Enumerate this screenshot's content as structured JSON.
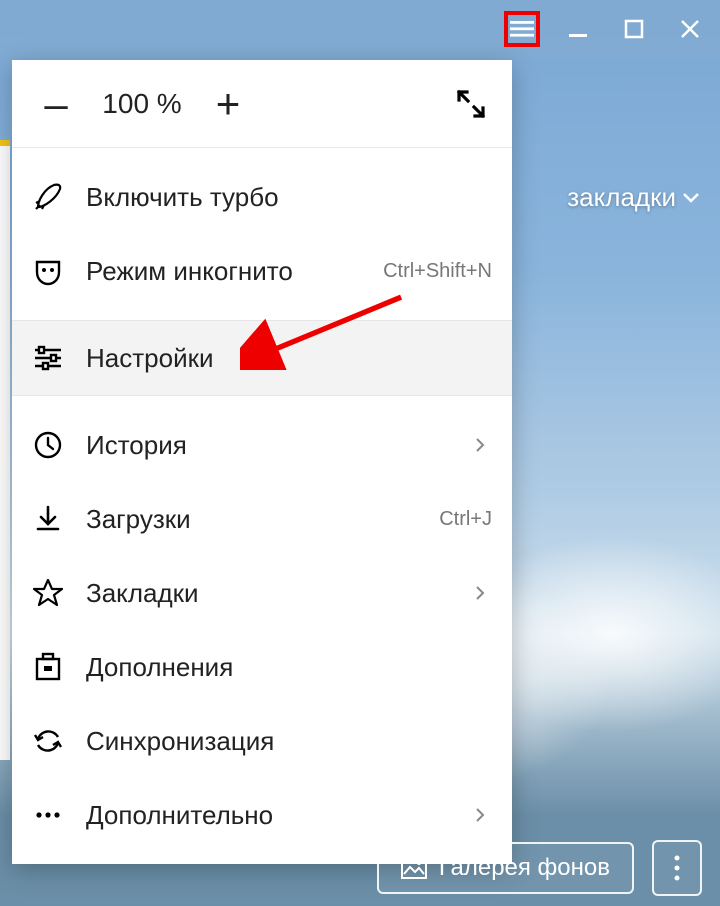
{
  "titlebar": {
    "hamburger": "hamburger",
    "minimize": "minimize",
    "maximize": "maximize",
    "close": "close"
  },
  "page": {
    "bookmarks_link": "закладки"
  },
  "menu": {
    "zoom": {
      "minus": "–",
      "value": "100 %",
      "plus": "+"
    },
    "items": [
      {
        "icon": "rocket",
        "label": "Включить турбо",
        "shortcut": "",
        "submenu": false,
        "hover": false
      },
      {
        "icon": "mask",
        "label": "Режим инкогнито",
        "shortcut": "Ctrl+Shift+N",
        "submenu": false,
        "hover": false
      },
      {
        "icon": "sliders",
        "label": "Настройки",
        "shortcut": "",
        "submenu": false,
        "hover": true
      },
      {
        "icon": "clock",
        "label": "История",
        "shortcut": "",
        "submenu": true,
        "hover": false
      },
      {
        "icon": "download",
        "label": "Загрузки",
        "shortcut": "Ctrl+J",
        "submenu": false,
        "hover": false
      },
      {
        "icon": "star",
        "label": "Закладки",
        "shortcut": "",
        "submenu": true,
        "hover": false
      },
      {
        "icon": "addon",
        "label": "Дополнения",
        "shortcut": "",
        "submenu": false,
        "hover": false
      },
      {
        "icon": "sync",
        "label": "Синхронизация",
        "shortcut": "",
        "submenu": false,
        "hover": false
      },
      {
        "icon": "dots",
        "label": "Дополнительно",
        "shortcut": "",
        "submenu": true,
        "hover": false
      }
    ]
  },
  "bottom": {
    "gallery_label": "Галерея фонов"
  }
}
